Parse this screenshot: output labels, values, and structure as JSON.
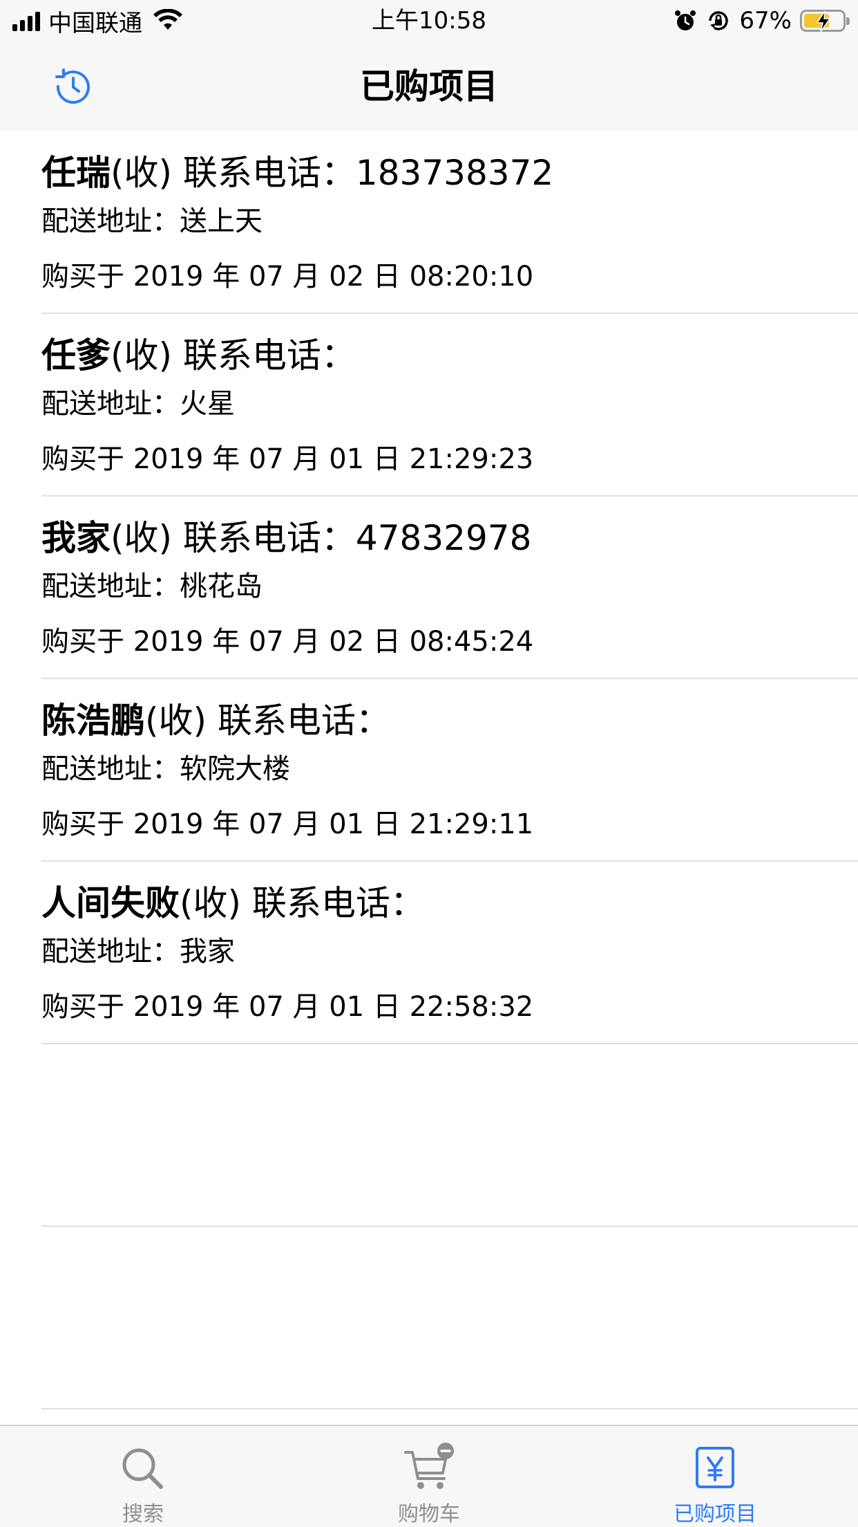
{
  "status_bar": {
    "carrier": "中国联通",
    "time": "上午10:58",
    "battery_percent": "67%",
    "battery_level": 0.67,
    "icons": [
      "signal-icon",
      "wifi-icon",
      "alarm-icon",
      "orientation-lock-icon",
      "battery-icon"
    ]
  },
  "nav": {
    "title": "已购项目",
    "left_icon": "refresh-history-icon"
  },
  "orders": [
    {
      "name": "任瑞",
      "recv": "(收)",
      "phone_label": "联系电话：",
      "phone": "183738372",
      "address_label": "配送地址：",
      "address": "送上天",
      "purchased": "购买于 2019 年 07 月 02 日 08:20:10"
    },
    {
      "name": "任爹",
      "recv": "(收)",
      "phone_label": "联系电话：",
      "phone": "",
      "address_label": "配送地址：",
      "address": "火星",
      "purchased": "购买于 2019 年 07 月 01 日 21:29:23"
    },
    {
      "name": "我家",
      "recv": "(收)",
      "phone_label": "联系电话：",
      "phone": "47832978",
      "address_label": "配送地址：",
      "address": "桃花岛",
      "purchased": "购买于 2019 年 07 月 02 日 08:45:24"
    },
    {
      "name": "陈浩鹏",
      "recv": "(收)",
      "phone_label": "联系电话：",
      "phone": "",
      "address_label": "配送地址：",
      "address": "软院大楼",
      "purchased": "购买于 2019 年 07 月 01 日 21:29:11"
    },
    {
      "name": "人间失败",
      "recv": "(收)",
      "phone_label": "联系电话：",
      "phone": "",
      "address_label": "配送地址：",
      "address": "我家",
      "purchased": "购买于 2019 年 07 月 01 日 22:58:32"
    }
  ],
  "tabs": [
    {
      "label": "搜索",
      "icon": "search-icon",
      "active": false
    },
    {
      "label": "购物车",
      "icon": "cart-icon",
      "active": false
    },
    {
      "label": "已购项目",
      "icon": "yen-receipt-icon",
      "active": true
    }
  ],
  "colors": {
    "accent": "#2f7bf5",
    "inactive_tab": "#8e8e93",
    "bar_background": "#f7f7f7",
    "separator": "#e0e0e0",
    "battery_charging": "#f4c430"
  }
}
